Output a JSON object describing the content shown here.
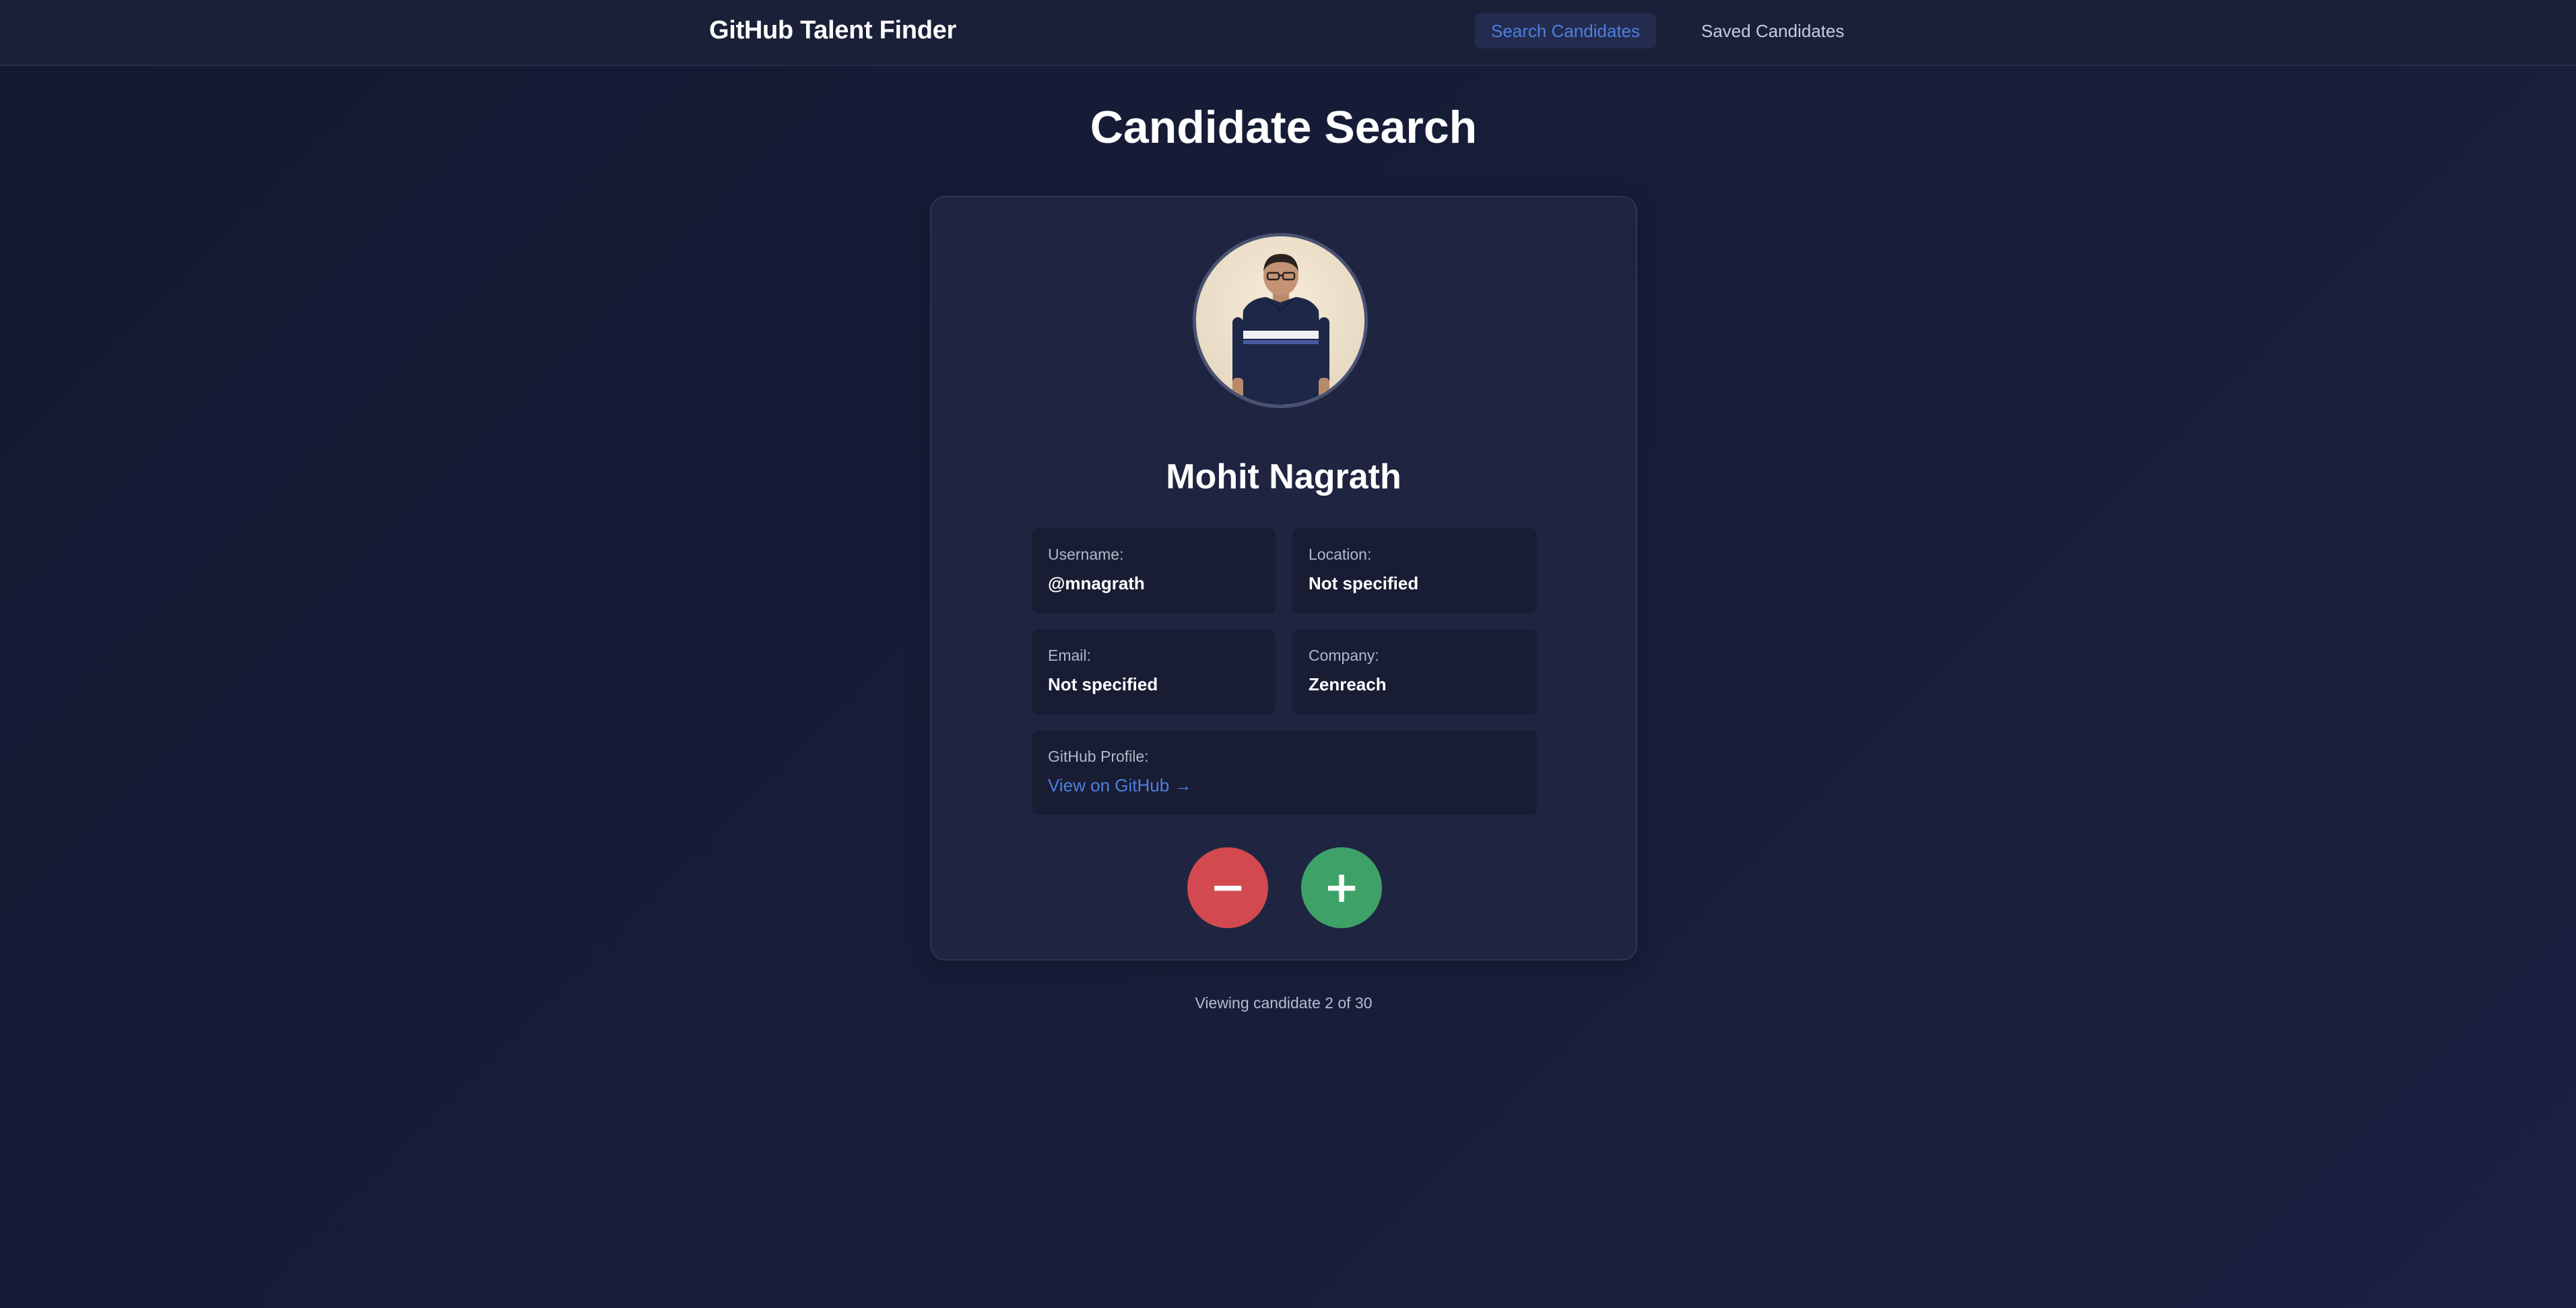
{
  "header": {
    "brand": "GitHub Talent Finder",
    "nav": {
      "search": "Search Candidates",
      "saved": "Saved Candidates"
    }
  },
  "page": {
    "title": "Candidate Search"
  },
  "candidate": {
    "name": "Mohit Nagrath",
    "fields": {
      "username_label": "Username:",
      "username_value": "@mnagrath",
      "location_label": "Location:",
      "location_value": "Not specified",
      "email_label": "Email:",
      "email_value": "Not specified",
      "company_label": "Company:",
      "company_value": "Zenreach",
      "github_label": "GitHub Profile:",
      "github_link": "View on GitHub →"
    }
  },
  "actions": {
    "reject_symbol": "−",
    "accept_symbol": "+"
  },
  "status": "Viewing candidate 2 of 30",
  "colors": {
    "accent": "#4f7fe0",
    "reject": "#d24a4f",
    "accept": "#3ea268",
    "card": "#1f2540",
    "background": "#171d38"
  },
  "icons": {
    "reject": "minus-icon",
    "accept": "plus-icon"
  }
}
